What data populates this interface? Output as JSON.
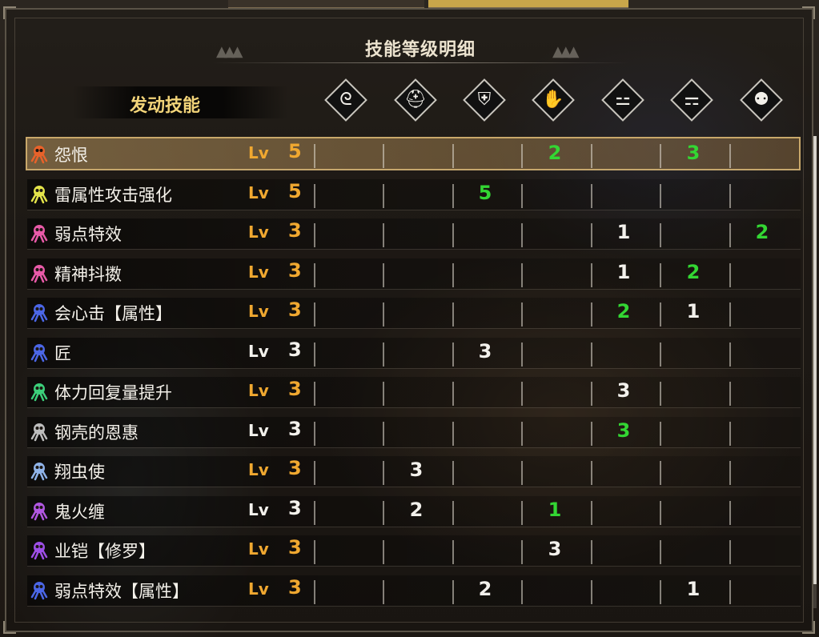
{
  "title": "技能等级明细",
  "skills_header": "发动技能",
  "equipment_icons": [
    {
      "name": "weapon-icon",
      "glyph": "ᘓ"
    },
    {
      "name": "helm-icon",
      "glyph": "⛑"
    },
    {
      "name": "chest-icon",
      "glyph": "⛨"
    },
    {
      "name": "arms-icon",
      "glyph": "✋"
    },
    {
      "name": "waist-icon",
      "glyph": "⚍"
    },
    {
      "name": "legs-icon",
      "glyph": "⚎"
    },
    {
      "name": "talisman-icon",
      "glyph": "⚉"
    }
  ],
  "lv_label": "Lv",
  "colors": {
    "gold": "#f0a830",
    "white": "#f3f1ec",
    "green": "#33d633",
    "selection": "#c9a86a"
  },
  "skills": [
    {
      "name": "怨恨",
      "icon_color": "#e8622a",
      "level": "5",
      "lv_color": "gold",
      "values": [
        "",
        "",
        "",
        "2",
        "",
        "3",
        ""
      ],
      "value_colors": [
        "",
        "",
        "",
        "green",
        "",
        "green",
        ""
      ],
      "selected": true
    },
    {
      "name": "雷属性攻击强化",
      "icon_color": "#e3e34a",
      "level": "5",
      "lv_color": "gold",
      "values": [
        "",
        "",
        "5",
        "",
        "",
        "",
        ""
      ],
      "value_colors": [
        "",
        "",
        "green",
        "",
        "",
        "",
        ""
      ],
      "selected": false
    },
    {
      "name": "弱点特效",
      "icon_color": "#e85aa8",
      "level": "3",
      "lv_color": "gold",
      "values": [
        "",
        "",
        "",
        "",
        "1",
        "",
        "2"
      ],
      "value_colors": [
        "",
        "",
        "",
        "",
        "white",
        "",
        "green"
      ],
      "selected": false
    },
    {
      "name": "精神抖擞",
      "icon_color": "#e85aa8",
      "level": "3",
      "lv_color": "gold",
      "values": [
        "",
        "",
        "",
        "",
        "1",
        "2",
        ""
      ],
      "value_colors": [
        "",
        "",
        "",
        "",
        "white",
        "green",
        ""
      ],
      "selected": false
    },
    {
      "name": "会心击【属性】",
      "icon_color": "#4b66e6",
      "level": "3",
      "lv_color": "gold",
      "values": [
        "",
        "",
        "",
        "",
        "2",
        "1",
        ""
      ],
      "value_colors": [
        "",
        "",
        "",
        "",
        "green",
        "white",
        ""
      ],
      "selected": false
    },
    {
      "name": "匠",
      "icon_color": "#4b66e6",
      "level": "3",
      "lv_color": "white",
      "values": [
        "",
        "",
        "3",
        "",
        "",
        "",
        ""
      ],
      "value_colors": [
        "",
        "",
        "white",
        "",
        "",
        "",
        ""
      ],
      "selected": false
    },
    {
      "name": "体力回复量提升",
      "icon_color": "#3ccf7a",
      "level": "3",
      "lv_color": "gold",
      "values": [
        "",
        "",
        "",
        "",
        "3",
        "",
        ""
      ],
      "value_colors": [
        "",
        "",
        "",
        "",
        "white",
        "",
        ""
      ],
      "selected": false
    },
    {
      "name": "钢壳的恩惠",
      "icon_color": "#bdbdbd",
      "level": "3",
      "lv_color": "white",
      "values": [
        "",
        "",
        "",
        "",
        "3",
        "",
        ""
      ],
      "value_colors": [
        "",
        "",
        "",
        "",
        "green",
        "",
        ""
      ],
      "selected": false
    },
    {
      "name": "翔虫使",
      "icon_color": "#8fb3e8",
      "level": "3",
      "lv_color": "gold",
      "values": [
        "",
        "3",
        "",
        "",
        "",
        "",
        ""
      ],
      "value_colors": [
        "",
        "white",
        "",
        "",
        "",
        "",
        ""
      ],
      "selected": false
    },
    {
      "name": "鬼火缠",
      "icon_color": "#b057e0",
      "level": "3",
      "lv_color": "white",
      "values": [
        "",
        "2",
        "",
        "1",
        "",
        "",
        ""
      ],
      "value_colors": [
        "",
        "white",
        "",
        "green",
        "",
        "",
        ""
      ],
      "selected": false
    },
    {
      "name": "业铠【修罗】",
      "icon_color": "#9d4fe6",
      "level": "3",
      "lv_color": "gold",
      "values": [
        "",
        "",
        "",
        "3",
        "",
        "",
        ""
      ],
      "value_colors": [
        "",
        "",
        "",
        "white",
        "",
        "",
        ""
      ],
      "selected": false
    },
    {
      "name": "弱点特效【属性】",
      "icon_color": "#4b66e6",
      "level": "3",
      "lv_color": "gold",
      "values": [
        "",
        "",
        "2",
        "",
        "",
        "1",
        ""
      ],
      "value_colors": [
        "",
        "",
        "white",
        "",
        "",
        "white",
        ""
      ],
      "selected": false
    }
  ]
}
